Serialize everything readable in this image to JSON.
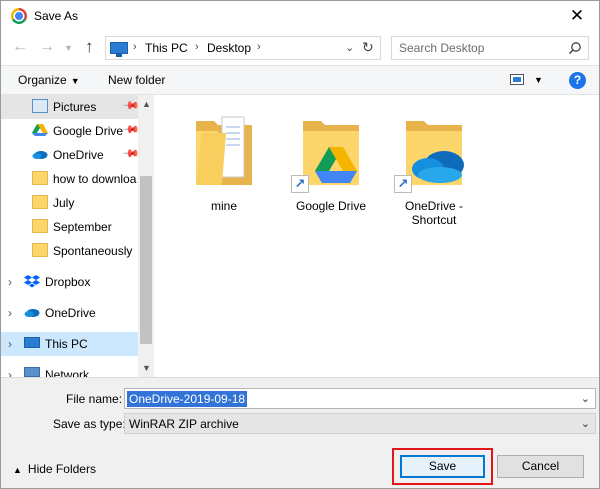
{
  "window": {
    "title": "Save As",
    "close_glyph": "✕"
  },
  "nav": {
    "back_glyph": "←",
    "forward_glyph": "→",
    "up_glyph": "↑",
    "breadcrumb": [
      "This PC",
      "Desktop"
    ],
    "search_placeholder": "Search Desktop"
  },
  "toolbar": {
    "organize_label": "Organize",
    "new_folder_label": "New folder",
    "help_label": "?"
  },
  "sidebar": {
    "quick_access": [
      {
        "label": "Pictures",
        "icon": "pictures-icon",
        "pinned": true
      },
      {
        "label": "Google Drive",
        "icon": "google-drive-icon",
        "pinned": true
      },
      {
        "label": "OneDrive",
        "icon": "onedrive-icon",
        "pinned": true
      },
      {
        "label": "how to downloa",
        "icon": "folder-icon",
        "pinned": false
      },
      {
        "label": "July",
        "icon": "folder-icon",
        "pinned": false
      },
      {
        "label": "September",
        "icon": "folder-icon",
        "pinned": false
      },
      {
        "label": "Spontaneously",
        "icon": "folder-icon",
        "pinned": false
      }
    ],
    "top_level": [
      {
        "label": "Dropbox",
        "icon": "dropbox-icon"
      },
      {
        "label": "OneDrive",
        "icon": "onedrive-icon"
      },
      {
        "label": "This PC",
        "icon": "this-pc-icon",
        "selected": true
      },
      {
        "label": "Network",
        "icon": "network-icon"
      }
    ]
  },
  "files": [
    {
      "name": "mine",
      "type": "folder"
    },
    {
      "name": "Google Drive",
      "type": "shortcut"
    },
    {
      "name": "OneDrive - Shortcut",
      "type": "shortcut"
    }
  ],
  "form": {
    "file_name_label": "File name:",
    "file_name_value": "OneDrive-2019-09-18",
    "save_type_label": "Save as type:",
    "save_type_value": "WinRAR ZIP archive"
  },
  "footer": {
    "hide_folders_label": "Hide Folders",
    "save_label": "Save",
    "cancel_label": "Cancel"
  },
  "colors": {
    "accent": "#0078d7",
    "selection": "#3173d6",
    "highlight_box": "#e3141b",
    "folder": "#fcd66a"
  }
}
